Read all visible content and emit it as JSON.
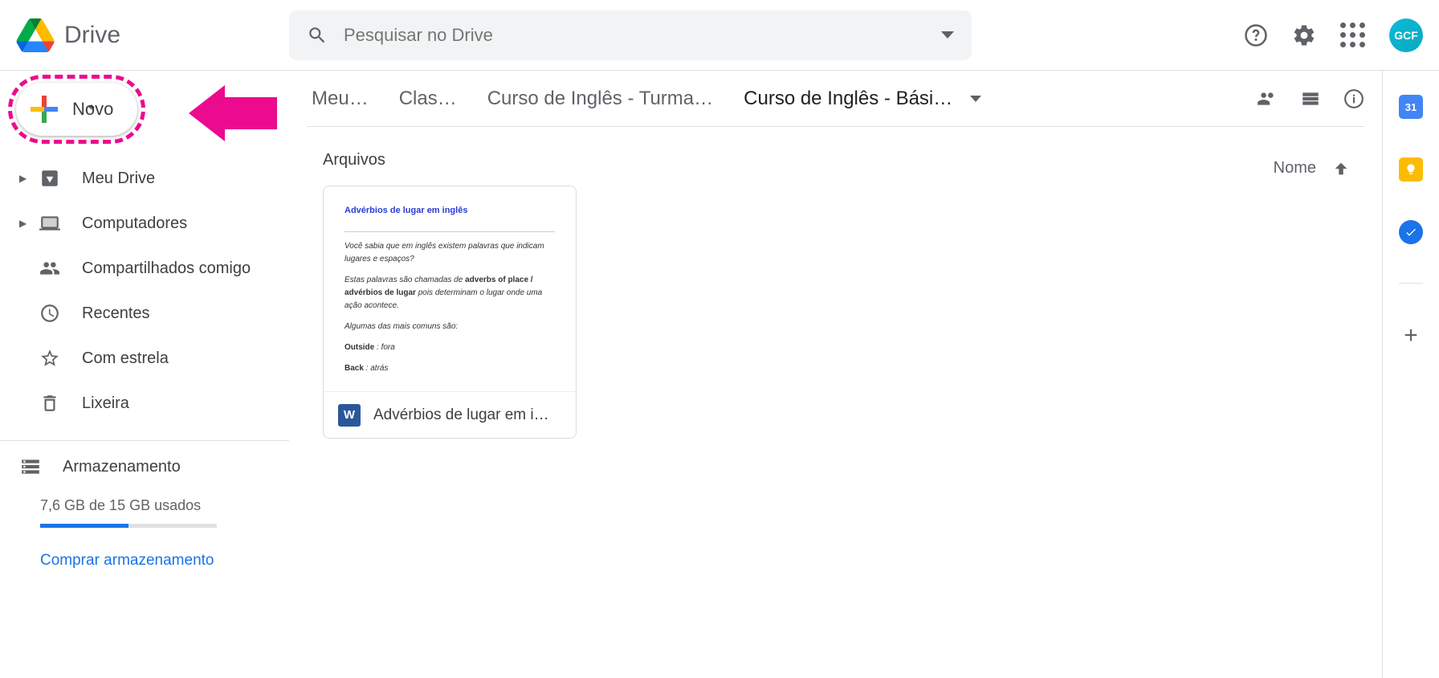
{
  "header": {
    "app_name": "Drive",
    "search_placeholder": "Pesquisar no Drive",
    "avatar_label": "GCF"
  },
  "annotation": {
    "highlight_color": "#ec0a8f"
  },
  "sidebar": {
    "new_label": "Novo",
    "items": [
      {
        "label": "Meu Drive",
        "icon": "drive",
        "expandable": true
      },
      {
        "label": "Computadores",
        "icon": "computers",
        "expandable": true
      },
      {
        "label": "Compartilhados comigo",
        "icon": "shared",
        "expandable": false
      },
      {
        "label": "Recentes",
        "icon": "recent",
        "expandable": false
      },
      {
        "label": "Com estrela",
        "icon": "starred",
        "expandable": false
      },
      {
        "label": "Lixeira",
        "icon": "trash",
        "expandable": false
      }
    ],
    "storage": {
      "label": "Armazenamento",
      "used_text": "7,6 GB de 15 GB usados",
      "buy_link": "Comprar armazenamento",
      "fill_percent": 50
    }
  },
  "breadcrumb": {
    "items": [
      "Meu…",
      "Clas…",
      "Curso de Inglês - Turma…",
      "Curso de Inglês - Bási…"
    ]
  },
  "content": {
    "section_title": "Arquivos",
    "sort_label": "Nome",
    "files": [
      {
        "display_name": "Advérbios de lugar em i…",
        "type": "word",
        "preview": {
          "title": "Advérbios de lugar em inglês",
          "p1": "Você sabia que em inglês existem palavras que indicam lugares e espaços?",
          "p2_a": "Estas palavras são chamadas de ",
          "p2_b": "adverbs of place / advérbios de lugar",
          "p2_c": " pois determinam o lugar onde uma ação acontece.",
          "p3": "Algumas das mais comuns são:",
          "l1_a": "Outside",
          "l1_b": " : fora",
          "l2_a": "Back",
          "l2_b": " : atrás"
        }
      }
    ]
  },
  "sidepanel": {
    "calendar_day": "31"
  }
}
